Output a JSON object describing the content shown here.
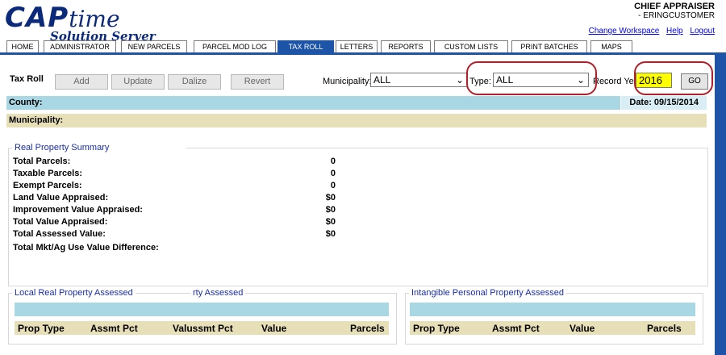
{
  "app": {
    "logo_main": "CAP",
    "logo_script": "time",
    "logo_sub": "Solution Server"
  },
  "user": {
    "role": "CHIEF APPRAISER",
    "name": "- ERINGCUSTOMER"
  },
  "links": {
    "change_workspace": "Change Workspace",
    "help": "Help",
    "logout": "Logout"
  },
  "tabs": [
    {
      "label": "HOME"
    },
    {
      "label": "ADMINISTRATOR"
    },
    {
      "label": "NEW PARCELS"
    },
    {
      "label": "PARCEL MOD LOG"
    },
    {
      "label": "TAX ROLL",
      "active": true
    },
    {
      "label": "LETTERS"
    },
    {
      "label": "REPORTS"
    },
    {
      "label": "CUSTOM LISTS"
    },
    {
      "label": "PRINT BATCHES"
    },
    {
      "label": "MAPS"
    }
  ],
  "toolbar": {
    "title": "Tax Roll",
    "add": "Add",
    "update": "Update",
    "finalize": "Dalize",
    "revert": "Revert",
    "municipality_label": "Municipality:",
    "municipality_value": "ALL",
    "type_label": "Type:",
    "type_value": "ALL",
    "record_year_label": "Record Year",
    "record_year_value": "2016",
    "go": "GO"
  },
  "info": {
    "county_label": "County:",
    "date": "Date: 09/15/2014",
    "municipality_label": "Municipality:"
  },
  "summary": {
    "legend": "Real Property Summary",
    "rows": [
      {
        "label": "Total Parcels:",
        "value": "0"
      },
      {
        "label": "Taxable Parcels:",
        "value": "0"
      },
      {
        "label": "Exempt Parcels:",
        "value": "0"
      },
      {
        "label": "Land Value Appraised:",
        "value": "$0"
      },
      {
        "label": "Improvement Value Appraised:",
        "value": "$0"
      },
      {
        "label": "Total Value Appraised:",
        "value": "$0"
      },
      {
        "label": "Total Assessed Value:",
        "value": "$0"
      },
      {
        "label": "Total Mkt/Ag Use Value Difference:",
        "value": ""
      }
    ]
  },
  "local_real": {
    "legend": "Local Real Property Assessed",
    "legend2": "rty Assessed",
    "headers": [
      "Prop Type",
      "Assmt Pct",
      "Valussmt Pct",
      "Value",
      "Parcels"
    ]
  },
  "intangible": {
    "legend": "Intangible Personal Property Assessed",
    "headers": [
      "Prop Type",
      "Assmt Pct",
      "Value",
      "Parcels"
    ]
  },
  "colors": {
    "brand_blue": "#1d54a8",
    "highlight_red": "#b0202a",
    "county_bar": "#a9d7e3",
    "muni_bar": "#e7dfb8",
    "year_yellow": "#ffff00"
  }
}
